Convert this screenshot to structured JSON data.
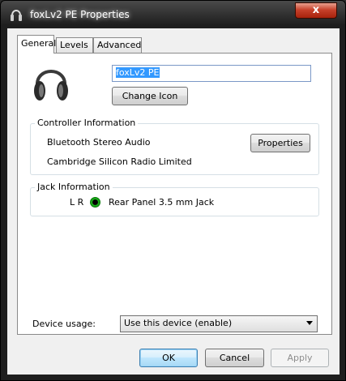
{
  "window": {
    "title": "foxLv2 PE Properties",
    "close_glyph": "x"
  },
  "tabs": [
    {
      "label": "General",
      "active": true
    },
    {
      "label": "Levels",
      "active": false
    },
    {
      "label": "Advanced",
      "active": false
    }
  ],
  "general": {
    "device_icon": "headphones-icon",
    "device_name": "foxLv2 PE",
    "change_icon_label": "Change Icon",
    "controller": {
      "title": "Controller Information",
      "name": "Bluetooth Stereo Audio",
      "manufacturer": "Cambridge Silicon Radio Limited",
      "properties_label": "Properties"
    },
    "jack": {
      "title": "Jack Information",
      "channels": "L R",
      "jack_color": "#1fc61f",
      "location": "Rear Panel 3.5 mm Jack"
    },
    "device_usage_label": "Device usage:",
    "device_usage_value": "Use this device (enable)"
  },
  "footer": {
    "ok": "OK",
    "cancel": "Cancel",
    "apply": "Apply"
  }
}
